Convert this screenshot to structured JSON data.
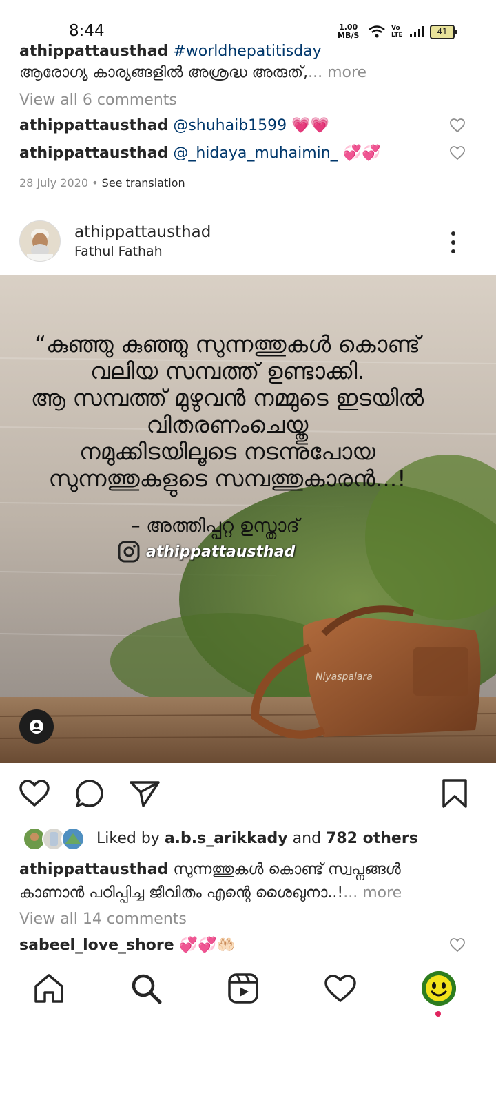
{
  "status_bar": {
    "time": "8:44",
    "speed_value": "1.00",
    "speed_unit": "MB/S",
    "network": "Vo LTE",
    "battery": "41"
  },
  "prev_post": {
    "caption_username": "athippattausthad",
    "caption_tag": "#worldhepatitisday",
    "caption_text": "ആരോഗ്യ കാര്യങ്ങളിൽ അശ്രദ്ധ അരുത്,",
    "more_label": "... more",
    "view_comments": "View all 6 comments",
    "comments": [
      {
        "username": "athippattausthad",
        "mention": "@shuhaib1599",
        "emoji": "💗💗"
      },
      {
        "username": "athippattausthad",
        "mention": "@_hidaya_muhaimin_",
        "emoji": "💞💞"
      }
    ],
    "date": "28 July 2020",
    "separator": "•",
    "see_translation": "See translation"
  },
  "post": {
    "username": "athippattausthad",
    "location": "Fathul Fathah",
    "quote_lines": [
      "“കുഞ്ഞു കുഞ്ഞു സുന്നത്തുകൾ കൊണ്ട്",
      "വലിയ സമ്പത്ത് ഉണ്ടാക്കി.",
      "ആ സമ്പത്ത് മുഴുവൻ നമ്മുടെ ഇടയിൽ",
      "വിതരണംചെയ്തു",
      "നമുക്കിടയിലൂടെ നടന്നുപോയ",
      "സുന്നത്തുകളുടെ സമ്പത്തുകാരൻ...!"
    ],
    "quote_author": "– അത്തിപ്പറ്റ ഉസ്താദ്",
    "image_handle": "athippattausthad",
    "watermark": "Niyaspalara",
    "liked_by_prefix": "Liked by",
    "liked_by_user": "a.b.s_arikkady",
    "liked_by_and": "and",
    "liked_by_others": "782 others",
    "caption_username": "athippattausthad",
    "caption_text": "സുന്നത്തുകൾ കൊണ്ട് സ്വപ്നങ്ങൾ കാണാൻ പഠിപ്പിച്ച ജീവിതം എന്റെ ശൈഖുനാ..!",
    "more_label": "... more",
    "view_comments": "View all 14 comments",
    "comment_username": "sabeel_love_shore",
    "comment_emoji": "💞💞🤲🏻"
  },
  "icons": {
    "like": "heart-icon",
    "comment": "comment-icon",
    "share": "send-icon",
    "save": "bookmark-icon",
    "home": "home-icon",
    "search": "search-icon",
    "reels": "reels-icon",
    "activity": "heart-icon",
    "more": "more-vertical-icon"
  },
  "colors": {
    "link": "#00376b",
    "muted": "#8e8e8e",
    "text": "#262626",
    "notification_dot": "#e0245e"
  }
}
